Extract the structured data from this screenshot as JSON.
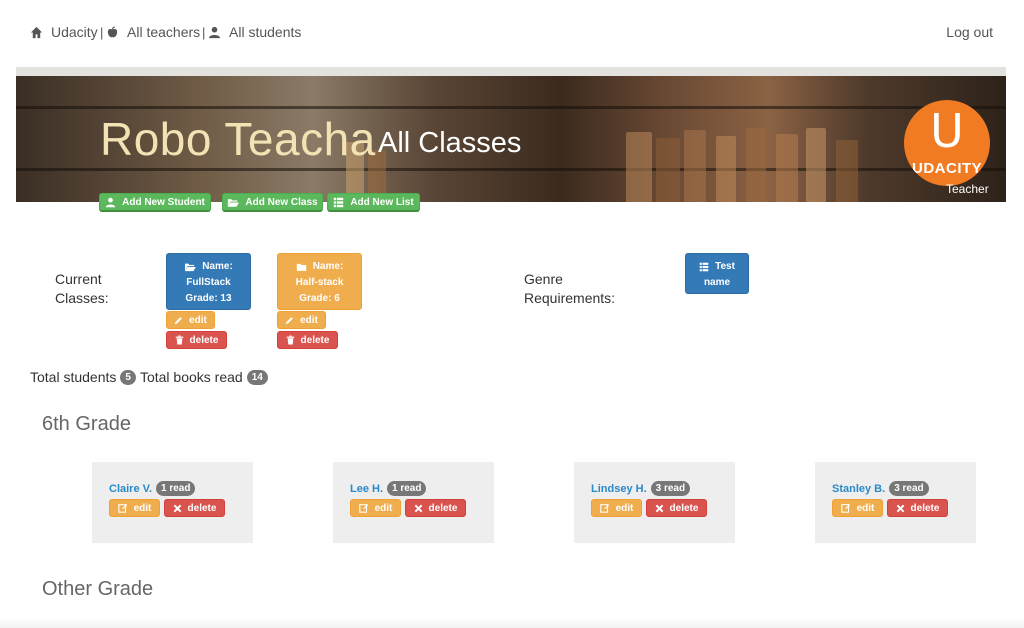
{
  "nav": {
    "home": "Udacity",
    "teachers": "All teachers",
    "students": "All students",
    "separator": "|",
    "logout": "Log out"
  },
  "header": {
    "brand": "Robo Teacha",
    "subtitle": "All Classes",
    "logo_letter": "U",
    "logo_word": "UDACITY",
    "role": "Teacher"
  },
  "actions": {
    "add_student": "Add New Student",
    "add_class": "Add New Class",
    "add_list": "Add New List"
  },
  "classes": {
    "label_line1": "Current",
    "label_line2": "Classes:",
    "items": [
      {
        "name_label": "Name:",
        "name": "FullStack",
        "grade": "Grade: 13",
        "color": "#337ab7",
        "edit": "edit",
        "delete": "delete"
      },
      {
        "name_label": "Name:",
        "name": "Half-stack",
        "grade": "Grade: 6",
        "color": "#f0ad4e",
        "edit": "edit",
        "delete": "delete"
      }
    ]
  },
  "genre": {
    "label_line1": "Genre",
    "label_line2": "Requirements:",
    "items": [
      {
        "line1": "Test",
        "line2": "name"
      }
    ]
  },
  "stats": {
    "students_label": "Total students",
    "students_count": "5",
    "books_label": "Total books read",
    "books_count": "14"
  },
  "groups": [
    {
      "title": "6th Grade",
      "students": [
        {
          "name": "Claire V.",
          "read": "1 read",
          "edit": "edit",
          "delete": "delete"
        },
        {
          "name": "Lee H.",
          "read": "1 read",
          "edit": "edit",
          "delete": "delete"
        },
        {
          "name": "Lindsey H.",
          "read": "3 read",
          "edit": "edit",
          "delete": "delete"
        },
        {
          "name": "Stanley B.",
          "read": "3 read",
          "edit": "edit",
          "delete": "delete"
        }
      ]
    },
    {
      "title": "Other Grade",
      "students": []
    }
  ],
  "icons": {
    "home": "home-icon",
    "teachers": "apple-icon",
    "students": "user-icon",
    "add_student": "user-icon",
    "add_class": "folder-open-icon",
    "add_list": "list-icon",
    "class_card": "folder-icon",
    "class_edit": "pencil-icon",
    "class_delete": "trash-icon",
    "genre_card": "list-icon",
    "student_edit": "edit-icon",
    "student_delete": "remove-icon"
  },
  "colors": {
    "brand_text": "#f3e3b4",
    "udacity_orange": "#f07b22",
    "success": "#5cb85c",
    "primary": "#337ab7",
    "warning": "#f0ad4e",
    "danger": "#d9534f",
    "link": "#2a8ac8"
  }
}
